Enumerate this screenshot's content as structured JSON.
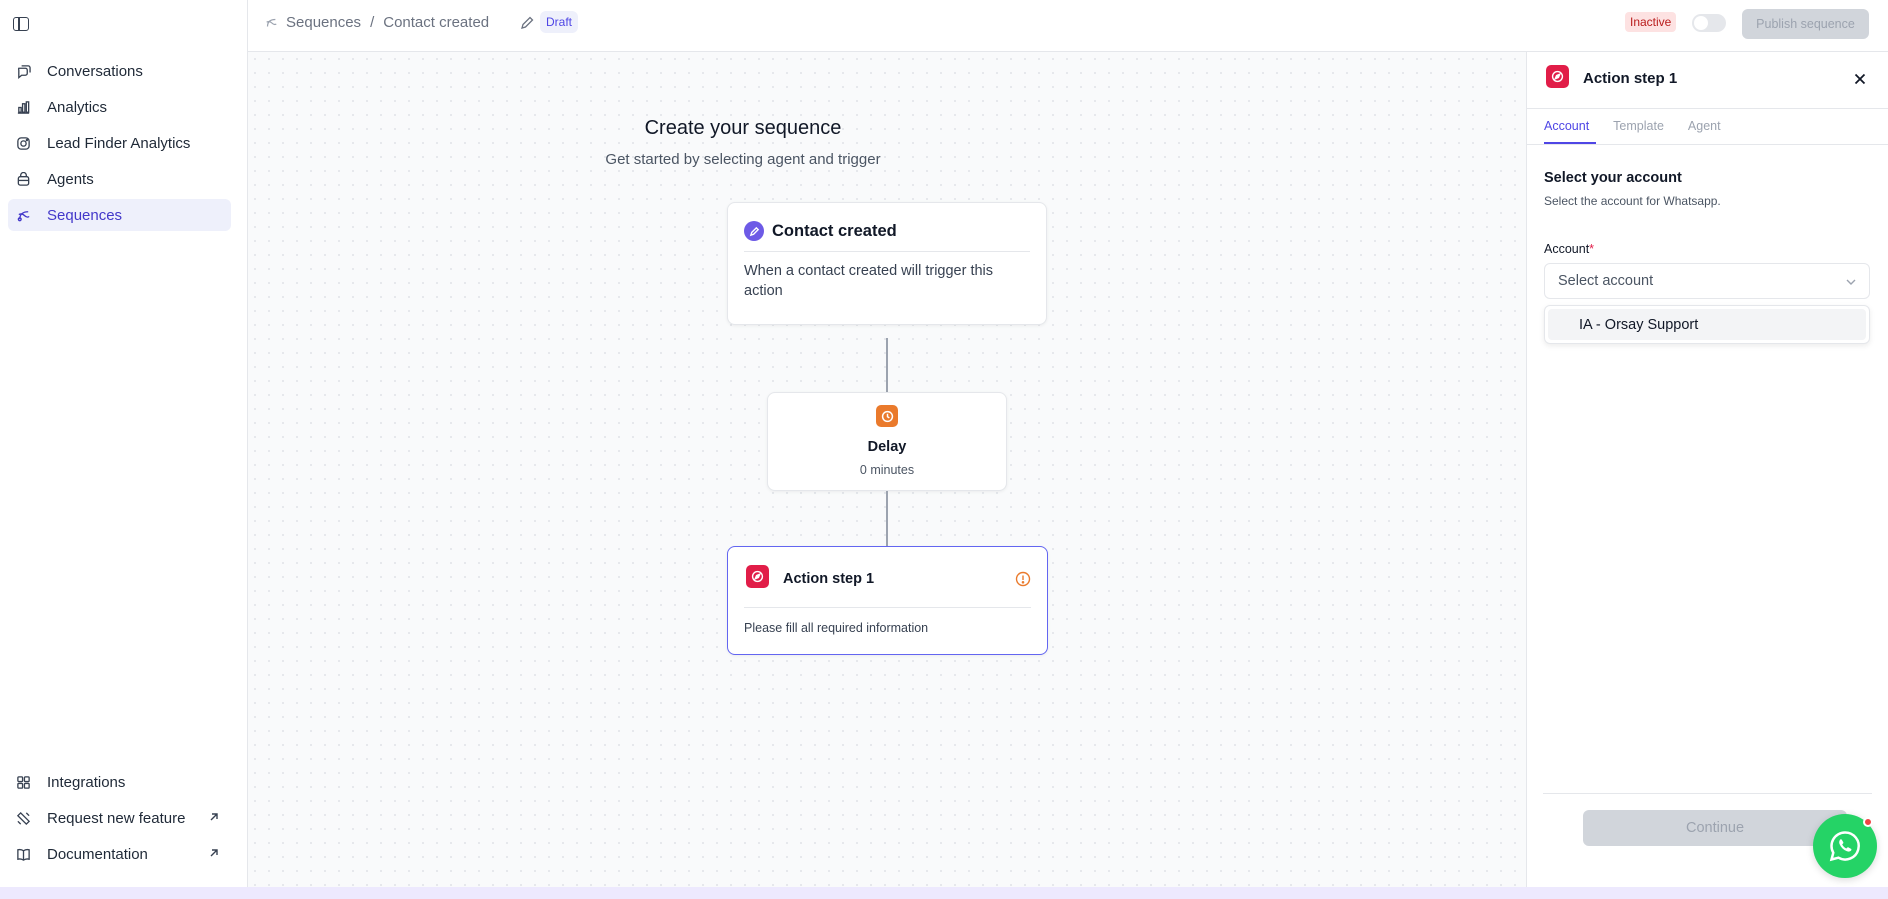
{
  "sidebar": {
    "nav": [
      {
        "label": "Conversations",
        "icon": "chat-icon"
      },
      {
        "label": "Analytics",
        "icon": "bar-chart-icon"
      },
      {
        "label": "Lead Finder Analytics",
        "icon": "instagram-icon"
      },
      {
        "label": "Agents",
        "icon": "agent-icon"
      },
      {
        "label": "Sequences",
        "icon": "sequence-icon",
        "active": true
      }
    ],
    "footer": [
      {
        "label": "Integrations",
        "icon": "grid-icon"
      },
      {
        "label": "Request new feature",
        "icon": "feature-icon"
      },
      {
        "label": "Documentation",
        "icon": "book-icon"
      }
    ]
  },
  "topbar": {
    "breadcrumb_root": "Sequences",
    "breadcrumb_separator": "/",
    "breadcrumb_current": "Contact created",
    "status_badge": "Draft",
    "active_state": "Inactive",
    "publish_label": "Publish sequence"
  },
  "canvas": {
    "title": "Create your sequence",
    "subtitle": "Get started by selecting agent and trigger",
    "trigger": {
      "title": "Contact created",
      "description": "When a contact created will trigger this action"
    },
    "delay": {
      "title": "Delay",
      "value": "0 minutes"
    },
    "action": {
      "title": "Action step 1",
      "message": "Please fill all required information"
    }
  },
  "panel": {
    "title": "Action step 1",
    "tabs": [
      "Account",
      "Template",
      "Agent"
    ],
    "active_tab": "Account",
    "section_title": "Select your account",
    "section_subtitle": "Select the account for Whatsapp.",
    "field_label": "Account",
    "required_marker": "*",
    "select_placeholder": "Select account",
    "dropdown_options": [
      "IA - Orsay Support"
    ],
    "continue_label": "Continue"
  },
  "colors": {
    "accent": "#4f46e5",
    "action_red": "#e11d48",
    "delay_orange": "#ea7a2c",
    "whatsapp_green": "#25d366"
  }
}
